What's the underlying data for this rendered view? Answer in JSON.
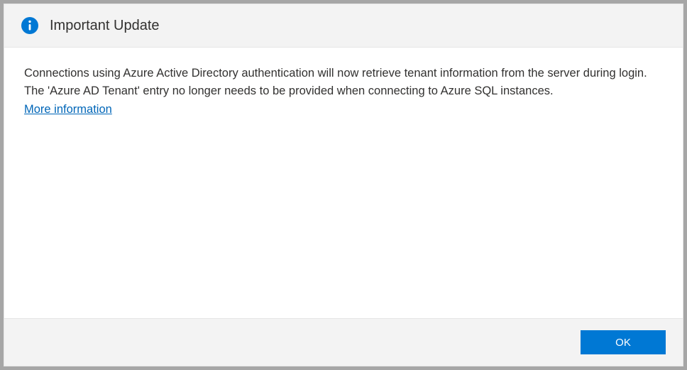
{
  "dialog": {
    "title": "Important Update",
    "message": "Connections using Azure Active Directory authentication will now retrieve tenant information from the server during login. The 'Azure AD Tenant' entry no longer needs to be provided when connecting to Azure SQL instances.",
    "more_link_label": "More information",
    "ok_button_label": "OK"
  },
  "colors": {
    "accent": "#0078d4",
    "link": "#0066b8",
    "header_bg": "#f3f3f3",
    "footer_bg": "#f3f3f3",
    "text": "#323130"
  }
}
